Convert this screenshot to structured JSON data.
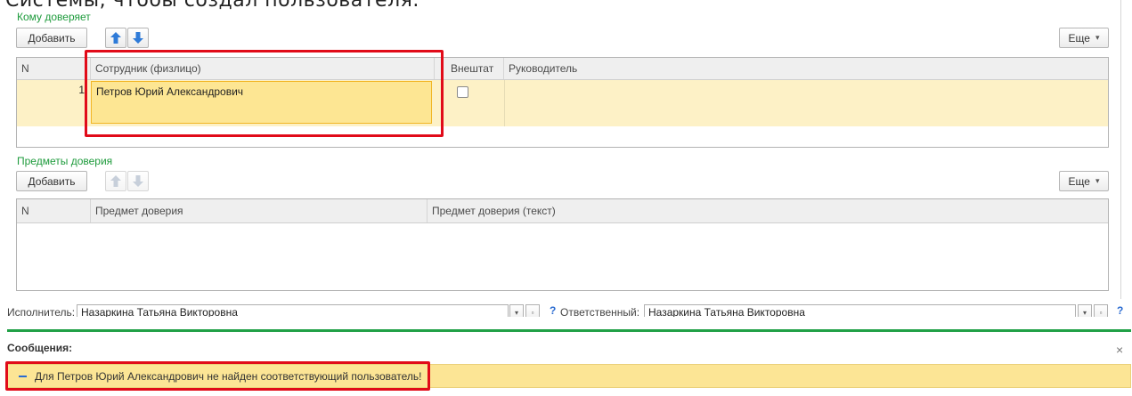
{
  "caption": "Системы, чтобы создал пользователя.",
  "trustees": {
    "title": "Кому доверяет",
    "add_label": "Добавить",
    "more_label": "Еще",
    "columns": [
      "N",
      "Сотрудник (физлицо)",
      "Внештат",
      "Руководитель"
    ],
    "rows": [
      {
        "n": "1",
        "employee": "Петров Юрий Александрович",
        "freelance": false,
        "manager": ""
      }
    ]
  },
  "subjects": {
    "title": "Предметы доверия",
    "add_label": "Добавить",
    "more_label": "Еще",
    "columns": [
      "N",
      "Предмет доверия",
      "Предмет доверия (текст)"
    ]
  },
  "footer": {
    "executor_label": "Исполнитель:",
    "executor_value": "Назаркина Татьяна Викторовна",
    "responsible_label": "Ответственный:",
    "responsible_value": "Назаркина Татьяна Викторовна",
    "help": "?"
  },
  "messages": {
    "title": "Сообщения:",
    "close": "×",
    "text": "Для Петров Юрий Александрович не найден соответствующий пользователь!"
  },
  "colors": {
    "accent_green": "#1e9b3c",
    "highlight_red": "#e10b19",
    "message_bg": "#fce595"
  }
}
